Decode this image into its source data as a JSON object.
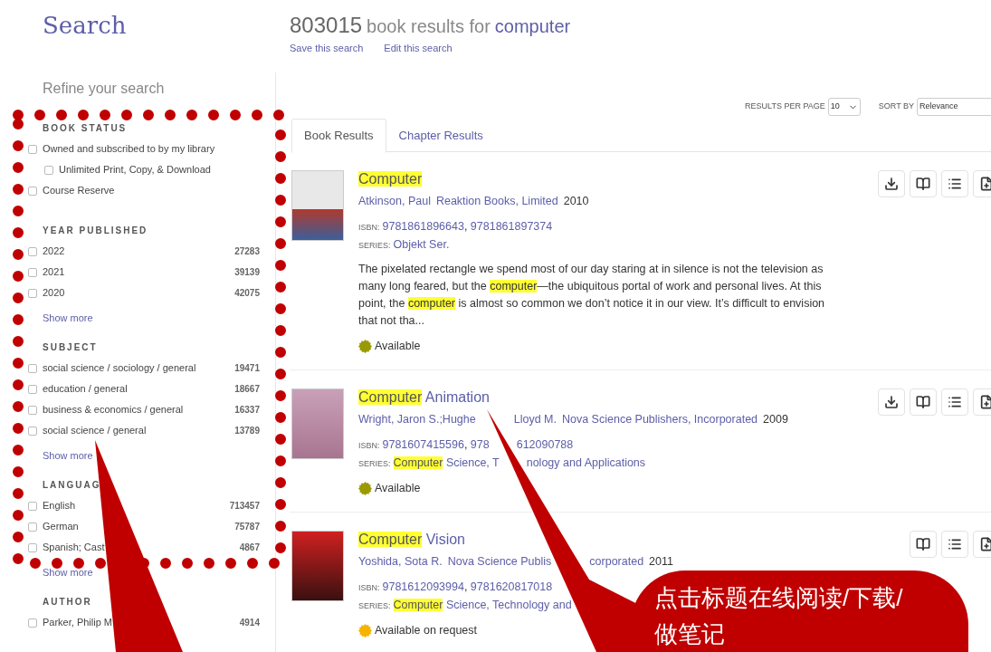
{
  "sidebar": {
    "title": "Search",
    "refine_label": "Refine your search",
    "filters": [
      {
        "heading": "BOOK STATUS",
        "items": [
          {
            "label": "Owned and subscribed to by my library",
            "checked": false,
            "children": [
              {
                "label": "Unlimited Print, Copy, & Download",
                "checked": false
              }
            ]
          },
          {
            "label": "Course Reserve",
            "checked": false
          }
        ]
      },
      {
        "heading": "YEAR PUBLISHED",
        "items": [
          {
            "label": "2022",
            "count": "27283",
            "checked": false
          },
          {
            "label": "2021",
            "count": "39139",
            "checked": false
          },
          {
            "label": "2020",
            "count": "42075",
            "checked": false
          }
        ],
        "show_more": "Show more"
      },
      {
        "heading": "SUBJECT",
        "items": [
          {
            "label": "social science / sociology / general",
            "count": "19471",
            "checked": false
          },
          {
            "label": "education / general",
            "count": "18667",
            "checked": false
          },
          {
            "label": "business & economics / general",
            "count": "16337",
            "checked": false
          },
          {
            "label": "social science / general",
            "count": "13789",
            "checked": false
          }
        ],
        "show_more": "Show more"
      },
      {
        "heading": "LANGUAG",
        "items": [
          {
            "label": "English",
            "count": "713457",
            "checked": false
          },
          {
            "label": "German",
            "count": "75787",
            "checked": false
          },
          {
            "label": "Spanish; Cast",
            "count": "4867",
            "checked": false
          }
        ],
        "show_more": "Show more"
      },
      {
        "heading": "AUTHOR",
        "items": [
          {
            "label": "Parker, Philip M",
            "count": "4914",
            "checked": false
          }
        ]
      }
    ]
  },
  "header": {
    "count": "803015",
    "phrase": "book results for",
    "query": "computer",
    "links": [
      "Save this search",
      "Edit this search"
    ]
  },
  "toolbar": {
    "per_page_label": "RESULTS PER PAGE",
    "per_page": "10",
    "sort_label": "SORT BY",
    "sort": "Relevance"
  },
  "tabs": [
    {
      "label": "Book Results",
      "selected": true
    },
    {
      "label": "Chapter Results",
      "selected": false
    }
  ],
  "results": [
    {
      "title": [
        {
          "kind": "mark",
          "text": "Computer"
        }
      ],
      "byline": [
        {
          "kind": "link",
          "text": "Atkinson, Paul"
        },
        {
          "kind": "link",
          "text": "Reaktion Books, Limited"
        },
        {
          "kind": "plain",
          "text": "2010"
        }
      ],
      "isbn_label": "ISBN:",
      "isbn": [
        {
          "kind": "link",
          "text": "9781861896643"
        },
        {
          "kind": "plain",
          "text": ", "
        },
        {
          "kind": "link",
          "text": "9781861897374"
        }
      ],
      "series_label": "SERIES:",
      "series": [
        {
          "kind": "link",
          "text": "Objekt Ser."
        }
      ],
      "description": [
        {
          "kind": "plain",
          "text": "The pixelated rectangle we spend most of our day staring at in silence is not the television as many long feared, but the "
        },
        {
          "kind": "mark",
          "text": "computer"
        },
        {
          "kind": "plain",
          "text": "—the ubiquitous portal of work and personal lives. At this point, the "
        },
        {
          "kind": "mark",
          "text": "computer"
        },
        {
          "kind": "plain",
          "text": " is almost so common we don’t notice it in our view. It’s difficult to envision that not tha..."
        }
      ],
      "status": {
        "text": "Available",
        "color": "#9a9a00"
      },
      "actions": [
        {
          "kind": "download"
        },
        {
          "kind": "read"
        },
        {
          "kind": "list"
        },
        {
          "kind": "note"
        }
      ]
    },
    {
      "title": [
        {
          "kind": "mark",
          "text": "Computer"
        },
        {
          "kind": "link",
          "text": " Animation"
        }
      ],
      "byline": [
        {
          "kind": "link",
          "text": "Wright, Jaron S.;Hughe"
        },
        {
          "kind": "covered"
        },
        {
          "kind": "link",
          "text": "Lloyd M."
        },
        {
          "kind": "link",
          "text": "Nova Science Publishers, Incorporated"
        },
        {
          "kind": "plain",
          "text": "2009"
        }
      ],
      "isbn_label": "ISBN:",
      "isbn": [
        {
          "kind": "link",
          "text": "9781607415596"
        },
        {
          "kind": "plain",
          "text": ", "
        },
        {
          "kind": "link",
          "text": "978"
        },
        {
          "kind": "covered"
        },
        {
          "kind": "link",
          "text": "612090788"
        }
      ],
      "series_label": "SERIES:",
      "series": [
        {
          "kind": "mark",
          "text": "Computer"
        },
        {
          "kind": "link",
          "text": " Science, T"
        },
        {
          "kind": "covered"
        },
        {
          "kind": "link",
          "text": "nology and Applications"
        }
      ],
      "status": {
        "text": "Available",
        "color": "#9a9a00"
      },
      "actions": [
        {
          "kind": "download"
        },
        {
          "kind": "read"
        },
        {
          "kind": "list"
        },
        {
          "kind": "note"
        }
      ]
    },
    {
      "title": [
        {
          "kind": "mark",
          "text": "Computer"
        },
        {
          "kind": "link",
          "text": " Vision"
        }
      ],
      "byline": [
        {
          "kind": "link",
          "text": "Yoshida, Sota R."
        },
        {
          "kind": "link",
          "text": "Nova Science Publis"
        },
        {
          "kind": "covered"
        },
        {
          "kind": "link",
          "text": "corporated"
        },
        {
          "kind": "plain",
          "text": "2011"
        }
      ],
      "isbn_label": "ISBN:",
      "isbn": [
        {
          "kind": "link",
          "text": "9781612093994"
        },
        {
          "kind": "plain",
          "text": ", "
        },
        {
          "kind": "link",
          "text": "9781620817018"
        }
      ],
      "series_label": "SERIES:",
      "series": [
        {
          "kind": "mark",
          "text": "Computer"
        },
        {
          "kind": "link",
          "text": " Science, Technology and"
        }
      ],
      "status": {
        "text": "Available on request",
        "color": "#f5b400"
      },
      "actions": [
        {
          "kind": "read"
        },
        {
          "kind": "list"
        },
        {
          "kind": "note"
        }
      ]
    }
  ],
  "annotation": {
    "text": "点击标题在线阅读/下载/做笔记"
  }
}
